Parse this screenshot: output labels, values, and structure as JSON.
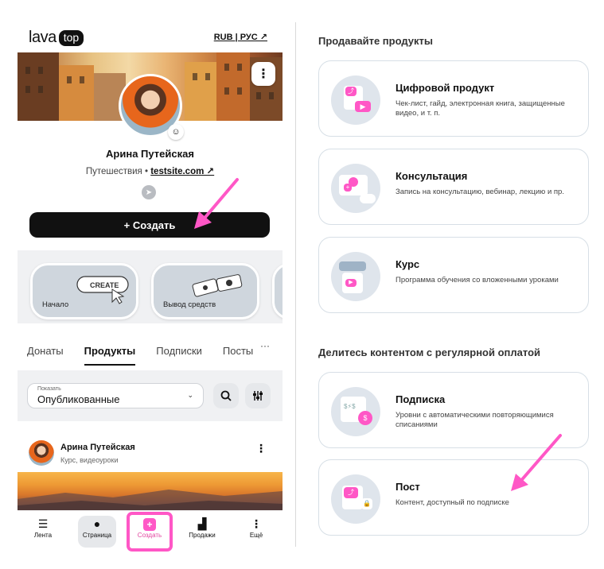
{
  "logo": {
    "text": "lava",
    "badge": "top"
  },
  "header": {
    "lang": "RUB | РУС ↗"
  },
  "profile": {
    "name": "Арина Путейская",
    "category": "Путешествия",
    "bullet": "•",
    "site": "testsite.com ↗"
  },
  "create_button": {
    "label": "+ Создать"
  },
  "quick_cards": [
    {
      "label": "Начало",
      "art": "CREATE"
    },
    {
      "label": "Вывод средств"
    }
  ],
  "tabs": [
    {
      "label": "Донаты"
    },
    {
      "label": "Продукты",
      "active": true
    },
    {
      "label": "Подписки"
    },
    {
      "label": "Посты"
    }
  ],
  "tabs_more": "···",
  "filter": {
    "caption": "Показать",
    "value": "Опубликованные",
    "chevron": "⌄"
  },
  "post": {
    "author": "Арина Путейская",
    "type": "Курс, видеоуроки",
    "more": "⋮"
  },
  "bottom_nav": [
    {
      "label": "Лента",
      "icon": "feed-icon"
    },
    {
      "label": "Страница",
      "icon": "person-icon"
    },
    {
      "label": "Создать",
      "icon": "plus-square-icon"
    },
    {
      "label": "Продажи",
      "icon": "bars-icon"
    },
    {
      "label": "Ещё",
      "icon": "dots-icon"
    }
  ],
  "right": {
    "section1_title": "Продавайте продукты",
    "section2_title": "Делитесь контентом с регулярной оплатой",
    "cards": [
      {
        "title": "Цифровой продукт",
        "desc": "Чек-лист, гайд, электронная книга, защищенные видео, и т. п.",
        "icon": "digital-product-icon"
      },
      {
        "title": "Консультация",
        "desc": "Запись на консультацию, вебинар, лекцию и пр.",
        "icon": "consultation-icon"
      },
      {
        "title": "Курс",
        "desc": "Программа обучения со вложенными уроками",
        "icon": "course-icon"
      },
      {
        "title": "Подписка",
        "desc": "Уровни с автоматическими повторяющимися списаниями",
        "icon": "subscription-icon"
      },
      {
        "title": "Пост",
        "desc": "Контент, доступный по подписке",
        "icon": "post-icon"
      }
    ]
  },
  "colors": {
    "accent": "#ff57c6",
    "dark": "#111111",
    "card_border": "#d7dfe6",
    "panel_bg": "#f0f1f3"
  }
}
